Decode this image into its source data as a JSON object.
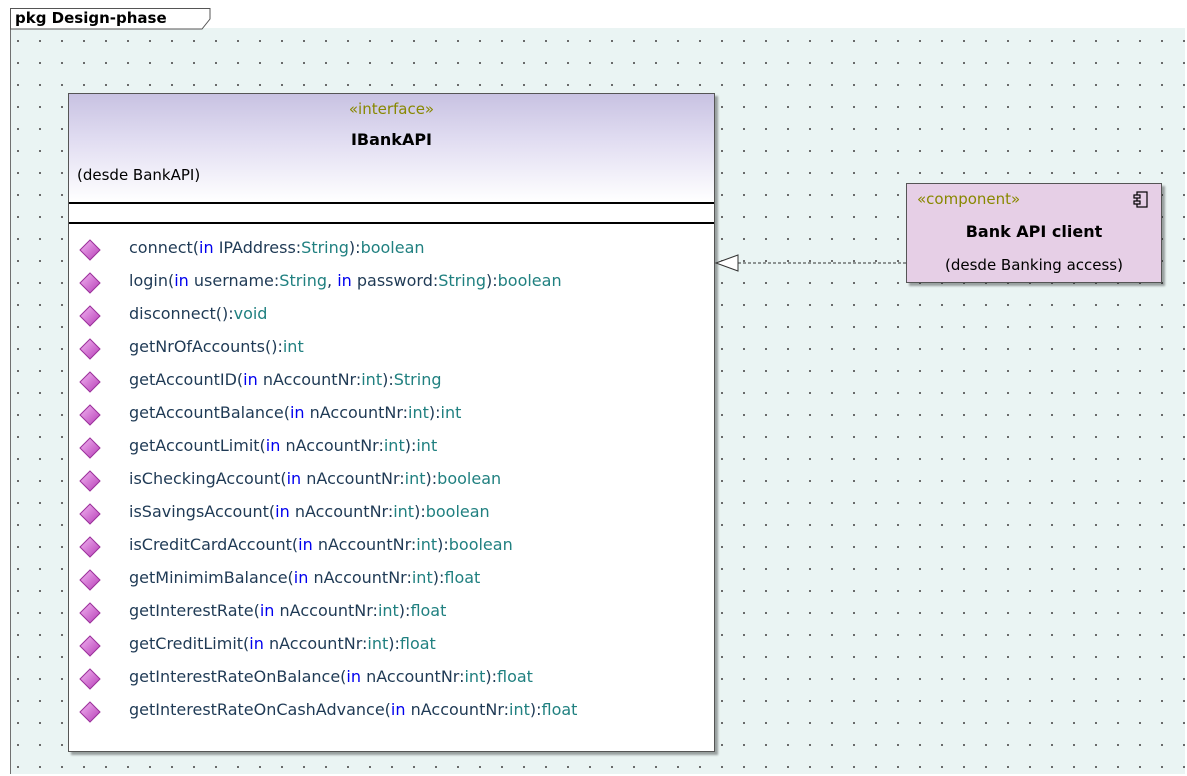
{
  "package": {
    "label": "pkg Design-phase"
  },
  "interface": {
    "stereotype": "«interface»",
    "name": "IBankAPI",
    "from": "(desde BankAPI)",
    "operations": [
      {
        "name": "connect(",
        "parts": [
          [
            "in",
            "kw"
          ],
          [
            " IPAddress:",
            ""
          ],
          [
            "String",
            "type"
          ],
          [
            "):",
            ""
          ],
          [
            "boolean",
            "type"
          ]
        ]
      },
      {
        "name": "login(",
        "parts": [
          [
            "in",
            "kw"
          ],
          [
            " username:",
            ""
          ],
          [
            "String",
            "type"
          ],
          [
            ",  ",
            ""
          ],
          [
            "in",
            "kw"
          ],
          [
            " password:",
            ""
          ],
          [
            "String",
            "type"
          ],
          [
            "):",
            ""
          ],
          [
            "boolean",
            "type"
          ]
        ]
      },
      {
        "name": "disconnect():",
        "parts": [
          [
            "void",
            "type"
          ]
        ]
      },
      {
        "name": "getNrOfAccounts():",
        "parts": [
          [
            "int",
            "type"
          ]
        ]
      },
      {
        "name": "getAccountID(",
        "parts": [
          [
            "in",
            "kw"
          ],
          [
            " nAccountNr:",
            ""
          ],
          [
            "int",
            "type"
          ],
          [
            "):",
            ""
          ],
          [
            "String",
            "type"
          ]
        ]
      },
      {
        "name": "getAccountBalance(",
        "parts": [
          [
            "in",
            "kw"
          ],
          [
            " nAccountNr:",
            ""
          ],
          [
            "int",
            "type"
          ],
          [
            "):",
            ""
          ],
          [
            "int",
            "type"
          ]
        ]
      },
      {
        "name": "getAccountLimit(",
        "parts": [
          [
            "in",
            "kw"
          ],
          [
            " nAccountNr:",
            ""
          ],
          [
            "int",
            "type"
          ],
          [
            "):",
            ""
          ],
          [
            "int",
            "type"
          ]
        ]
      },
      {
        "name": "isCheckingAccount(",
        "parts": [
          [
            "in",
            "kw"
          ],
          [
            " nAccountNr:",
            ""
          ],
          [
            "int",
            "type"
          ],
          [
            "):",
            ""
          ],
          [
            "boolean",
            "type"
          ]
        ]
      },
      {
        "name": "isSavingsAccount(",
        "parts": [
          [
            "in",
            "kw"
          ],
          [
            " nAccountNr:",
            ""
          ],
          [
            "int",
            "type"
          ],
          [
            "):",
            ""
          ],
          [
            "boolean",
            "type"
          ]
        ]
      },
      {
        "name": "isCreditCardAccount(",
        "parts": [
          [
            "in",
            "kw"
          ],
          [
            " nAccountNr:",
            ""
          ],
          [
            "int",
            "type"
          ],
          [
            "):",
            ""
          ],
          [
            "boolean",
            "type"
          ]
        ]
      },
      {
        "name": "getMinimimBalance(",
        "parts": [
          [
            "in",
            "kw"
          ],
          [
            " nAccountNr:",
            ""
          ],
          [
            "int",
            "type"
          ],
          [
            "):",
            ""
          ],
          [
            "float",
            "type"
          ]
        ]
      },
      {
        "name": "getInterestRate(",
        "parts": [
          [
            "in",
            "kw"
          ],
          [
            " nAccountNr:",
            ""
          ],
          [
            "int",
            "type"
          ],
          [
            "):",
            ""
          ],
          [
            "float",
            "type"
          ]
        ]
      },
      {
        "name": "getCreditLimit(",
        "parts": [
          [
            "in",
            "kw"
          ],
          [
            " nAccountNr:",
            ""
          ],
          [
            "int",
            "type"
          ],
          [
            "):",
            ""
          ],
          [
            "float",
            "type"
          ]
        ]
      },
      {
        "name": "getInterestRateOnBalance(",
        "parts": [
          [
            "in",
            "kw"
          ],
          [
            " nAccountNr:",
            ""
          ],
          [
            "int",
            "type"
          ],
          [
            "):",
            ""
          ],
          [
            "float",
            "type"
          ]
        ]
      },
      {
        "name": "getInterestRateOnCashAdvance(",
        "parts": [
          [
            "in",
            "kw"
          ],
          [
            " nAccountNr:",
            ""
          ],
          [
            "int",
            "type"
          ],
          [
            "):",
            ""
          ],
          [
            "float",
            "type"
          ]
        ]
      }
    ],
    "operation_icon": "public-operation-diamond-icon"
  },
  "component": {
    "stereotype": "«component»",
    "name": "Bank API client",
    "from": "(desde Banking access)",
    "icon": "component-icon"
  },
  "relationship": {
    "type": "realization",
    "from": "Bank API client",
    "to": "IBankAPI"
  },
  "colors": {
    "canvas": "#eaf4f3",
    "stereotype": "#888800",
    "keyword": "#0000ee",
    "type": "#208080",
    "component_fill": "#e6cfe6",
    "operation_icon": "#d86ad8"
  }
}
